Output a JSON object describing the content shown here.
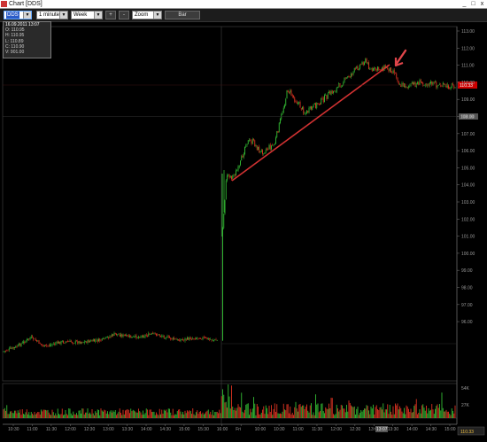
{
  "window": {
    "title": "Chart [DDS]",
    "controls": [
      "_",
      "□",
      "x"
    ]
  },
  "toolbar": {
    "symbol": "DDS",
    "interval": "1 minute",
    "range": "Week",
    "zoom_in_label": "+",
    "zoom_out_label": "-",
    "zoom_label": "Zoom",
    "bar_button_label": "Bar"
  },
  "info_box": {
    "header": "16.09.2011 13:07",
    "open": "O: 110.95",
    "high": "H: 110.95",
    "low": "L: 110.89",
    "close": "C: 110.90",
    "volume": "V: 901.00"
  },
  "price_axis": {
    "labels": [
      "113.00",
      "112.00",
      "111.00",
      "110.00",
      "109.00",
      "108.00",
      "107.00",
      "106.00",
      "105.00",
      "104.00",
      "103.00",
      "102.00",
      "101.00",
      "100.00",
      "99.00",
      "98.00",
      "97.00",
      "96.00"
    ],
    "last_price_tag": "110.33",
    "crosshair_tag": "108.00"
  },
  "volume_axis": {
    "labels": [
      "54K",
      "27K"
    ]
  },
  "time_axis": {
    "labels": [
      "10:30",
      "11:00",
      "11:30",
      "12:00",
      "12:30",
      "13:00",
      "13:30",
      "14:00",
      "14:30",
      "15:00",
      "15:30",
      "16:00",
      "Fri",
      "10:00",
      "10:30",
      "11:00",
      "11:30",
      "12:00",
      "12:30",
      "13:00",
      "13:30",
      "14:00",
      "14:30",
      "15:00"
    ],
    "crosshair_time": "13:07",
    "corner_value": "110.33"
  },
  "colors": {
    "up": "#33bb33",
    "down": "#dd3322",
    "trendline": "#d23232",
    "arrow": "#e0454a",
    "price_tag": "#cc0000"
  },
  "annotations": {
    "trendline": "red trend line under Friday rally",
    "arrow": "red arrow pointing down-left at 13:07"
  }
}
